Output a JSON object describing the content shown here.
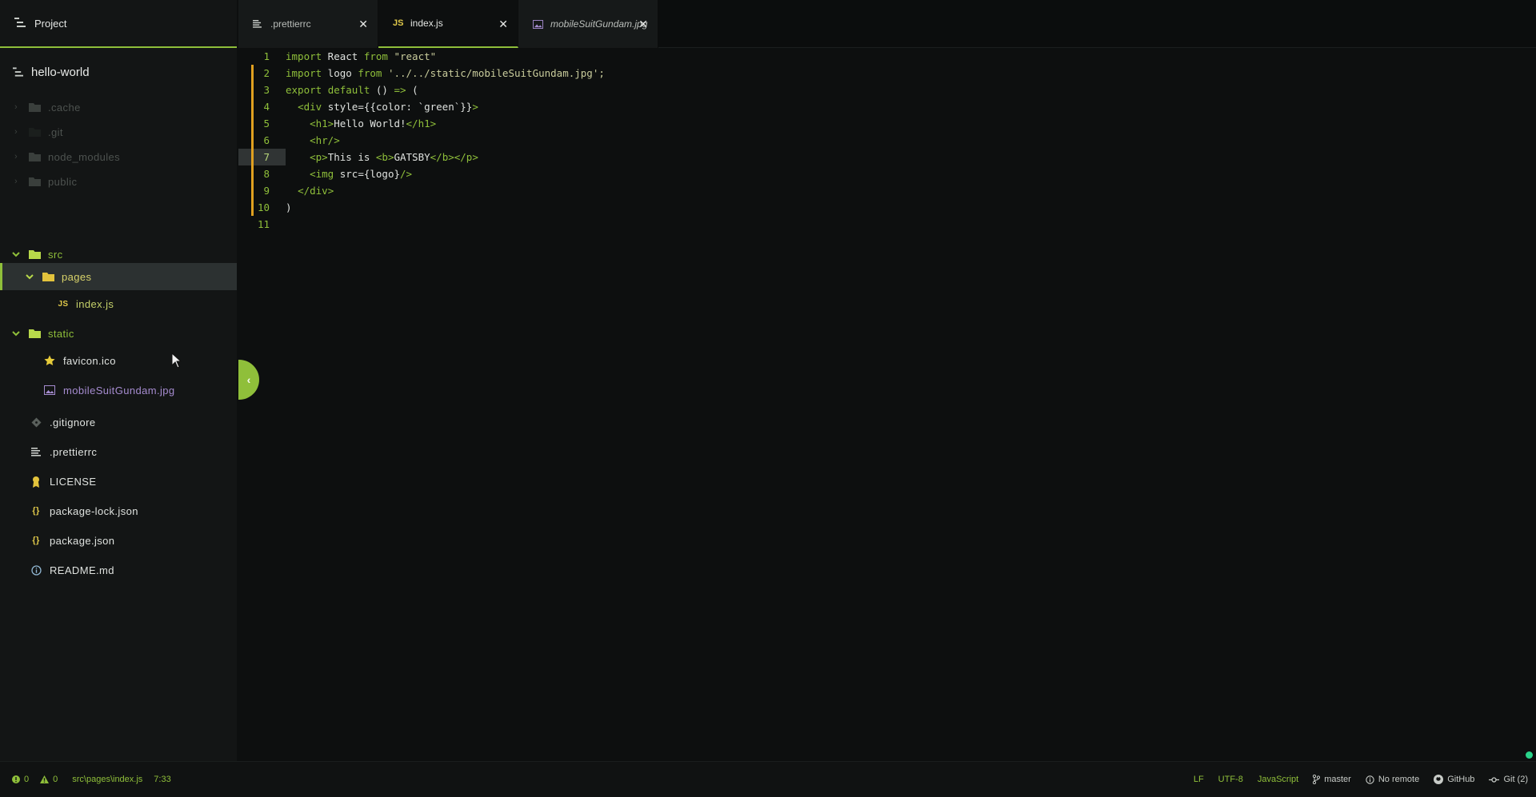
{
  "sidebar": {
    "title": "Project",
    "root": "hello-world",
    "items": [
      {
        "label": ".cache",
        "icon": "folder-icon"
      },
      {
        "label": ".git",
        "icon": "folder-icon"
      },
      {
        "label": "node_modules",
        "icon": "folder-icon"
      },
      {
        "label": "public",
        "icon": "folder-icon"
      },
      {
        "label": "src",
        "icon": "folder-open-icon"
      },
      {
        "label": "pages",
        "icon": "folder-open-icon"
      },
      {
        "label": "index.js",
        "icon": "javascript-file-icon",
        "icon_text": "JS"
      },
      {
        "label": "static",
        "icon": "folder-open-icon"
      },
      {
        "label": "favicon.ico",
        "icon": "star-icon"
      },
      {
        "label": "mobileSuitGundam.jpg",
        "icon": "image-file-icon"
      },
      {
        "label": ".gitignore",
        "icon": "git-icon"
      },
      {
        "label": ".prettierrc",
        "icon": "text-lines-icon"
      },
      {
        "label": "LICENSE",
        "icon": "license-ribbon-icon"
      },
      {
        "label": "package-lock.json",
        "icon": "json-braces-icon",
        "icon_text": "{}"
      },
      {
        "label": "package.json",
        "icon": "json-braces-icon",
        "icon_text": "{}"
      },
      {
        "label": "README.md",
        "icon": "info-icon"
      }
    ]
  },
  "tabs": [
    {
      "label": ".prettierrc",
      "icon": "text-lines-icon",
      "active": false
    },
    {
      "label": "index.js",
      "icon": "javascript-file-icon",
      "icon_text": "JS",
      "active": true
    },
    {
      "label": "mobileSuitGundam.jpg",
      "icon": "image-file-icon",
      "active": false
    }
  ],
  "tab_close_symbol": "✕",
  "editor": {
    "current_line": 7,
    "lines": [
      {
        "number": "1"
      },
      {
        "number": "2"
      },
      {
        "number": "3"
      },
      {
        "number": "4"
      },
      {
        "number": "5"
      },
      {
        "number": "6"
      },
      {
        "number": "7"
      },
      {
        "number": "8"
      },
      {
        "number": "9"
      },
      {
        "number": "10"
      },
      {
        "number": "11"
      }
    ],
    "tokens": {
      "l1": [
        "import",
        " React ",
        "from",
        " \"react\""
      ],
      "l2": [
        "import",
        " logo ",
        "from",
        " '../../static/mobileSuitGundam.jpg';"
      ],
      "l3": [
        "export",
        " ",
        "default",
        " () ",
        "=>",
        " ("
      ],
      "l4": [
        "  ",
        "<div",
        " style={{color: `green`}}",
        ">"
      ],
      "l5": [
        "    ",
        "<h1>",
        "Hello World!",
        "</h1>"
      ],
      "l6": [
        "    ",
        "<hr/>"
      ],
      "l7": [
        "    ",
        "<p>",
        "This is ",
        "<b>",
        "GATSBY",
        "</b></p>"
      ],
      "l8": [
        "    ",
        "<img",
        " src={logo}",
        "/>"
      ],
      "l9": [
        "  ",
        "</div>"
      ],
      "l10": [
        ")"
      ]
    }
  },
  "collapse_handle": "‹",
  "statusbar": {
    "errors": "0",
    "warnings": "0",
    "file_path": "src\\pages\\index.js",
    "cursor_position": "7:33",
    "line_ending": "LF",
    "encoding": "UTF-8",
    "grammar": "JavaScript",
    "branch": "master",
    "remote": "No remote",
    "github": "GitHub",
    "git": "Git (2)"
  },
  "colors": {
    "accent": "#8fbf3a",
    "modified_marker": "#e0a020",
    "status_dot": "#29d38a",
    "sidebar_bg": "#131515",
    "editor_bg": "#0d0f0f"
  }
}
